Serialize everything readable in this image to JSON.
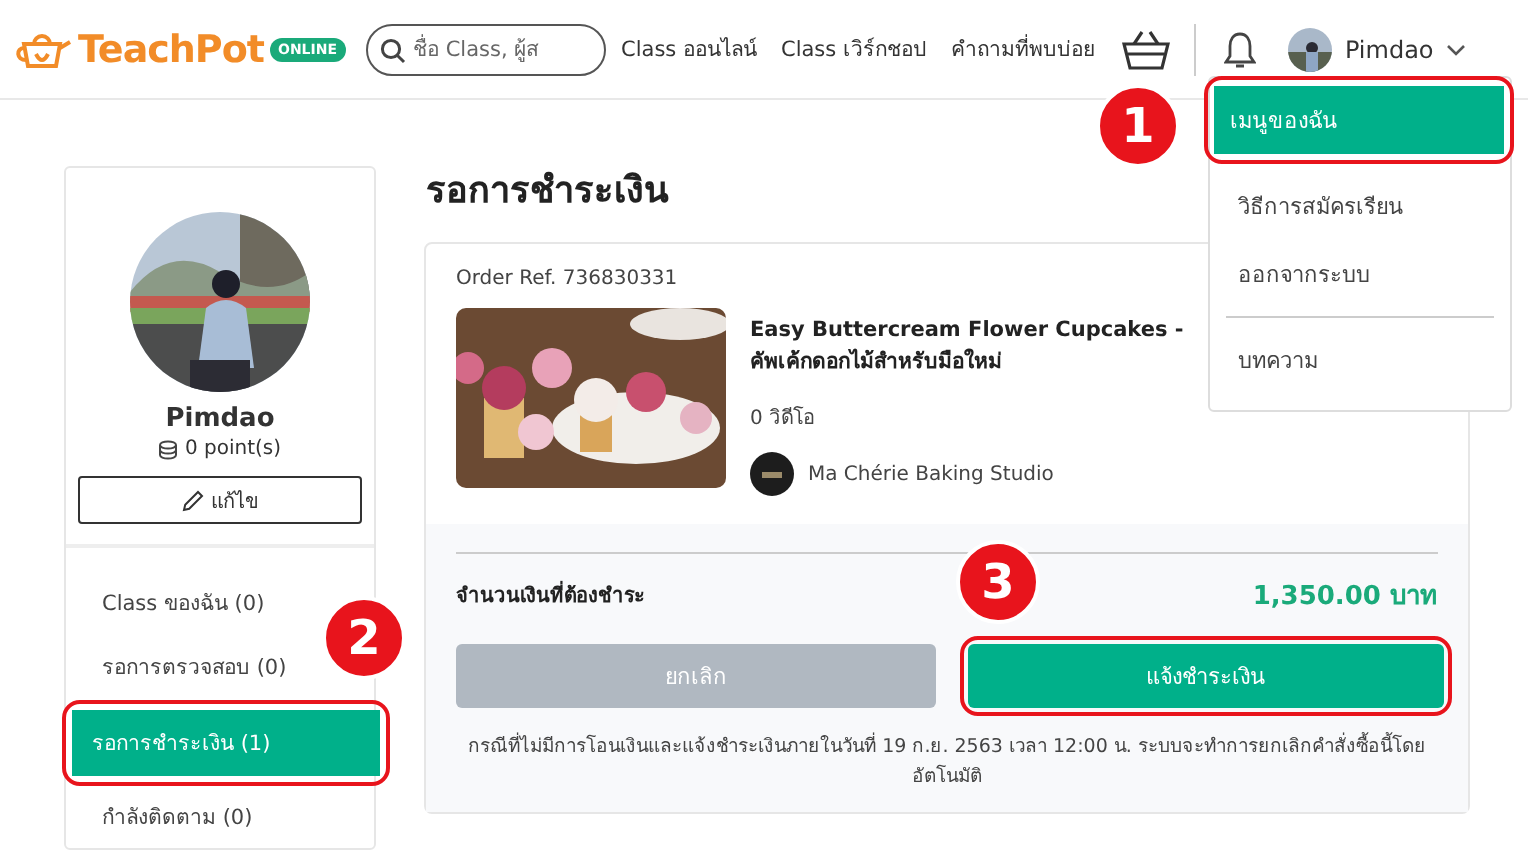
{
  "header": {
    "logo_text": "TeachPot",
    "logo_badge": "ONLINE",
    "search": {
      "placeholder": "ชื่อ Class, ผู้ส"
    },
    "nav": [
      "Class ออนไลน์",
      "Class เวิร์กชอป",
      "คำถามที่พบบ่อย"
    ],
    "user_name": "Pimdao"
  },
  "user_menu": {
    "callout": "1",
    "groups": [
      [
        {
          "label": "เมนูของฉัน",
          "selected": true
        },
        {
          "label": "วิธีการสมัครเรียน",
          "selected": false
        },
        {
          "label": "ออกจากระบบ",
          "selected": false
        }
      ],
      [
        {
          "label": "บทความ",
          "selected": false
        }
      ]
    ]
  },
  "profile": {
    "name": "Pimdao",
    "points": "0 point(s)",
    "edit_button": "แก้ไข",
    "callout": "2",
    "menu": [
      {
        "label": "Class ของฉัน (0)",
        "selected": false
      },
      {
        "label": "รอการตรวจสอบ (0)",
        "selected": false
      },
      {
        "label": "รอการชำระเงิน (1)",
        "selected": true
      },
      {
        "label": "กำลังติดตาม (0)",
        "selected": false
      }
    ]
  },
  "order": {
    "title": "รอการชำระเงิน",
    "ref": "Order Ref. 736830331",
    "course_title": "Easy Buttercream Flower Cupcakes - คัพเค้กดอกไม้สำหรับมือใหม่",
    "videos": "0 วิดีโอ",
    "studio": "Ma Chérie Baking Studio",
    "amount_label": "จำนวนเงินที่ต้องชำระ",
    "amount": "1,350.00 บาท",
    "cancel_button": "ยกเลิก",
    "pay_button": "แจ้งชำระเงิน",
    "callout": "3",
    "note": "กรณีที่ไม่มีการโอนเงินและแจ้งชำระเงินภายในวันที่ 19 ก.ย. 2563 เวลา 12:00 น. ระบบจะทำการยกเลิกคำสั่งซื้อนี้โดยอัตโนมัติ"
  }
}
